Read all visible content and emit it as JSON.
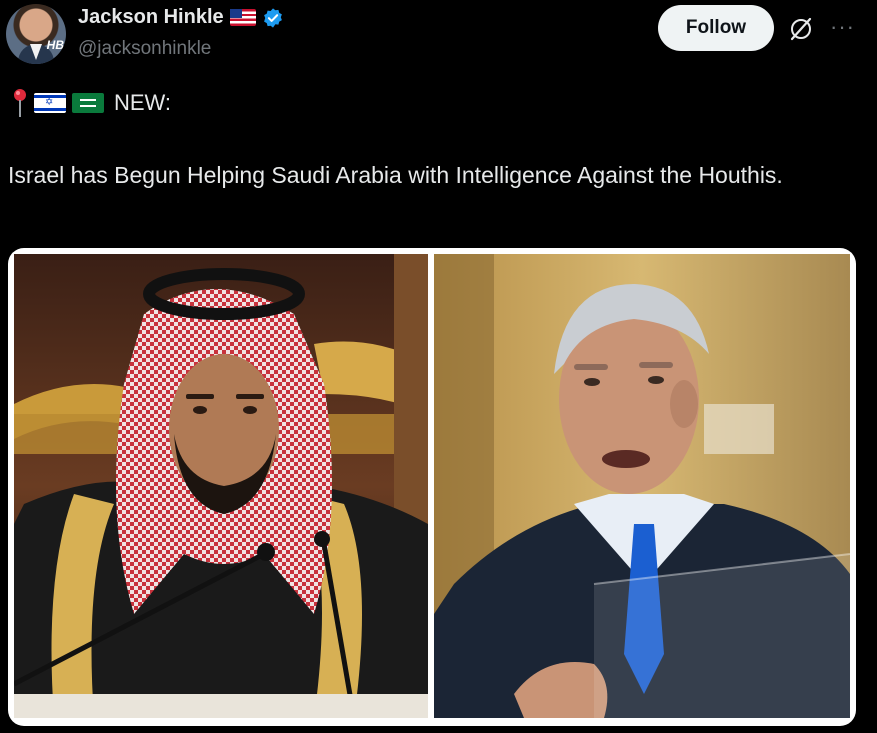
{
  "author": {
    "display_name": "Jackson Hinkle",
    "handle": "@jacksonhinkle",
    "avatar_badge": "HB",
    "flag_icon": "us-flag-icon",
    "verified_icon": "verified-badge-icon"
  },
  "actions": {
    "follow_label": "Follow",
    "grok_icon": "grok-icon",
    "more_icon": "more-options-icon"
  },
  "tweet": {
    "lead_emojis": [
      "pin-icon",
      "israel-flag-icon",
      "saudi-flag-icon"
    ],
    "lead_label": "NEW:",
    "text": "Israel has Begun Helping Saudi Arabia with Intelligence Against the Houthis."
  },
  "media": {
    "left_photo": "man-in-red-white-keffiyeh-photo",
    "right_photo": "man-in-suit-speaking-photo"
  },
  "colors": {
    "background": "#000000",
    "text": "#e7e9ea",
    "secondary_text": "#71767b",
    "follow_bg": "#eff3f4",
    "verified": "#1d9bf0"
  }
}
